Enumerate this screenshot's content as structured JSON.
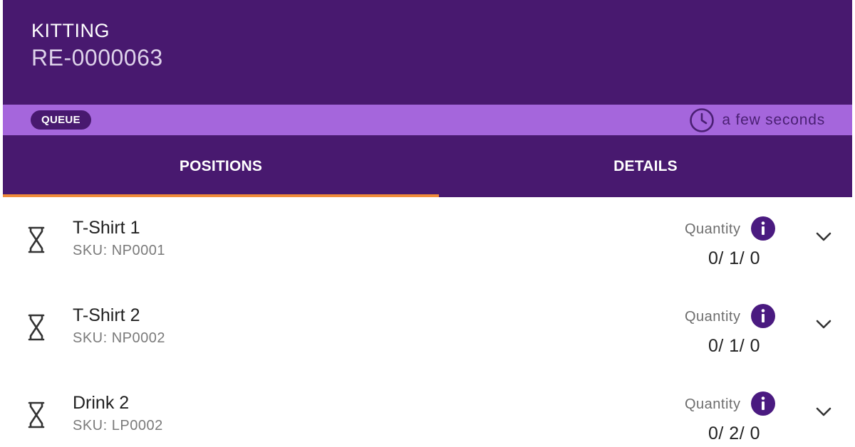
{
  "header": {
    "title": "KITTING",
    "document_number": "RE-0000063"
  },
  "status": {
    "badge": "QUEUE",
    "time_text": "a few seconds",
    "time_icon": "clock-icon"
  },
  "tabs": [
    {
      "label": "POSITIONS",
      "active": true
    },
    {
      "label": "DETAILS",
      "active": false
    }
  ],
  "positions": [
    {
      "name": "T-Shirt 1",
      "sku": "SKU: NP0001",
      "quantity_label": "Quantity",
      "quantity": "0/ 1/ 0",
      "status_icon": "hourglass-icon"
    },
    {
      "name": "T-Shirt 2",
      "sku": "SKU: NP0002",
      "quantity_label": "Quantity",
      "quantity": "0/ 1/ 0",
      "status_icon": "hourglass-icon"
    },
    {
      "name": "Drink 2",
      "sku": "SKU: LP0002",
      "quantity_label": "Quantity",
      "quantity": "0/ 2/ 0",
      "status_icon": "hourglass-icon"
    }
  ],
  "colors": {
    "primary": "#48196f",
    "secondary": "#a566dc",
    "tab_indicator": "#f08c3a",
    "info_icon": "#4a1a80"
  }
}
